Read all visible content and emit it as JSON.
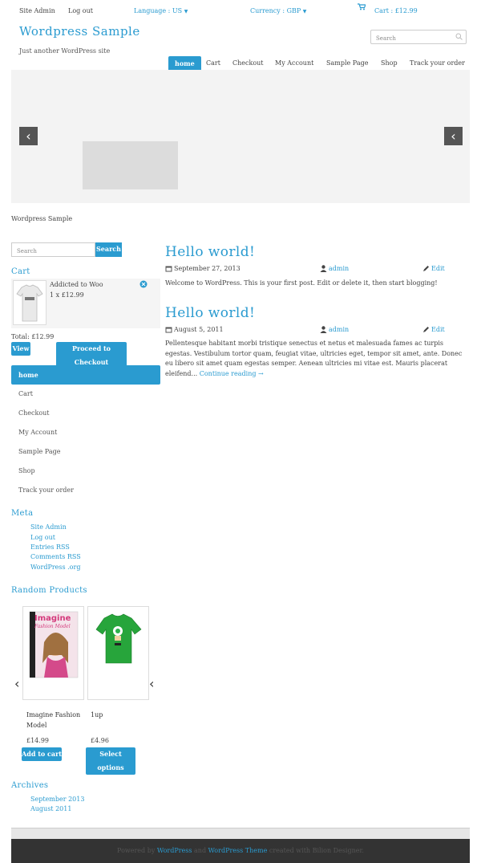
{
  "topbar": {
    "site_admin": "Site  Admin",
    "logout": "Log out",
    "language": "Language  : US",
    "currency": "Currency  : GBP",
    "cart": "Cart : £12.99"
  },
  "header": {
    "site_title": "Wordpress Sample",
    "tagline": "Just another WordPress site",
    "search_placeholder": "Search"
  },
  "nav": {
    "items": [
      "home",
      "Cart",
      "Checkout",
      "My Account",
      "Sample   Page",
      "Shop",
      "Track  your  order"
    ]
  },
  "breadcrumb": "Wordpress    Sample",
  "sidebar": {
    "search_placeholder": "Search",
    "search_button": "Search",
    "cart_title": "Cart",
    "cart_item_name": "Addicted to Woo",
    "cart_item_qty": "1 x £12.99",
    "cart_total": "Total: £12.99",
    "view_button": "View",
    "checkout_button": "Proceed to Checkout",
    "menu": [
      "home",
      "Cart",
      "Checkout",
      "My Account",
      "Sample    Page",
      "Shop",
      "Track  your  order"
    ],
    "meta_title": "Meta",
    "meta_links": [
      "Site  Admin",
      "Log out",
      "Entries   RSS",
      "Comments    RSS",
      "WordPress   .org"
    ],
    "random_title": "Random Products",
    "products": [
      {
        "name": "Imagine Fashion Model",
        "price": "£14.99",
        "button": "Add to cart",
        "cover_title": "Imagine",
        "cover_subtitle": "Fashion Model"
      },
      {
        "name": "1up",
        "price": "£4.96",
        "button": "Select options"
      }
    ],
    "archives_title": "Archives",
    "archives": [
      "September      2013",
      "August    2011"
    ]
  },
  "posts": [
    {
      "title": "Hello world!",
      "date": "September 27, 2013",
      "author": "admin",
      "edit": "Edit",
      "body": "Welcome to WordPress. This is your first post. Edit or delete it, then start blogging!",
      "more": ""
    },
    {
      "title": "Hello world!",
      "date": "August 5, 2011",
      "author": "admin",
      "edit": "Edit",
      "body": "Pellentesque habitant morbi tristique senectus et netus et malesuada fames ac turpis egestas. Vestibulum tortor quam, feugiat vitae, ultricies eget, tempor sit amet, ante. Donec eu libero sit amet quam egestas semper. Aenean ultricies mi vitae est. Mauris placerat eleifend...",
      "more": "Continue reading →"
    }
  ],
  "footer": {
    "powered": "Powered by",
    "wp": "WordPress",
    "and": "and",
    "theme": "WordPress Theme",
    "created": "created with Bilion Designer."
  },
  "colors": {
    "accent": "#2a9bd0",
    "footer": "#333333"
  }
}
